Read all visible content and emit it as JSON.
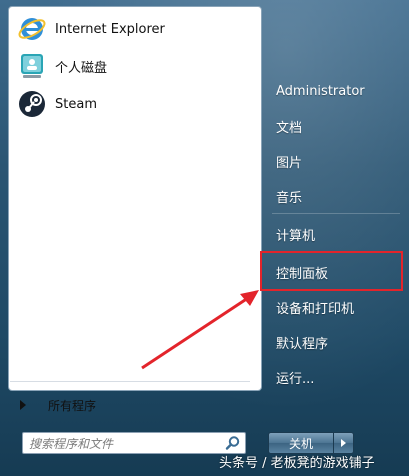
{
  "pinned_programs": [
    {
      "label": "Internet Explorer",
      "icon": "internet-explorer-icon"
    },
    {
      "label": "个人磁盘",
      "icon": "personal-disk-icon"
    },
    {
      "label": "Steam",
      "icon": "steam-icon"
    }
  ],
  "all_programs_label": "所有程序",
  "search": {
    "placeholder": "搜索程序和文件"
  },
  "right_pane": {
    "items": [
      {
        "label": "Administrator"
      },
      {
        "label": "文档"
      },
      {
        "label": "图片"
      },
      {
        "label": "音乐"
      },
      {
        "label": "计算机"
      },
      {
        "label": "控制面板"
      },
      {
        "label": "设备和打印机"
      },
      {
        "label": "默认程序"
      },
      {
        "label": "运行..."
      }
    ],
    "highlighted": "控制面板"
  },
  "shutdown_label": "关机",
  "watermark": "头条号 / 老板凳的游戏铺子",
  "colors": {
    "annotation_red": "#e3242b",
    "pane_bg": "#2a5573"
  }
}
